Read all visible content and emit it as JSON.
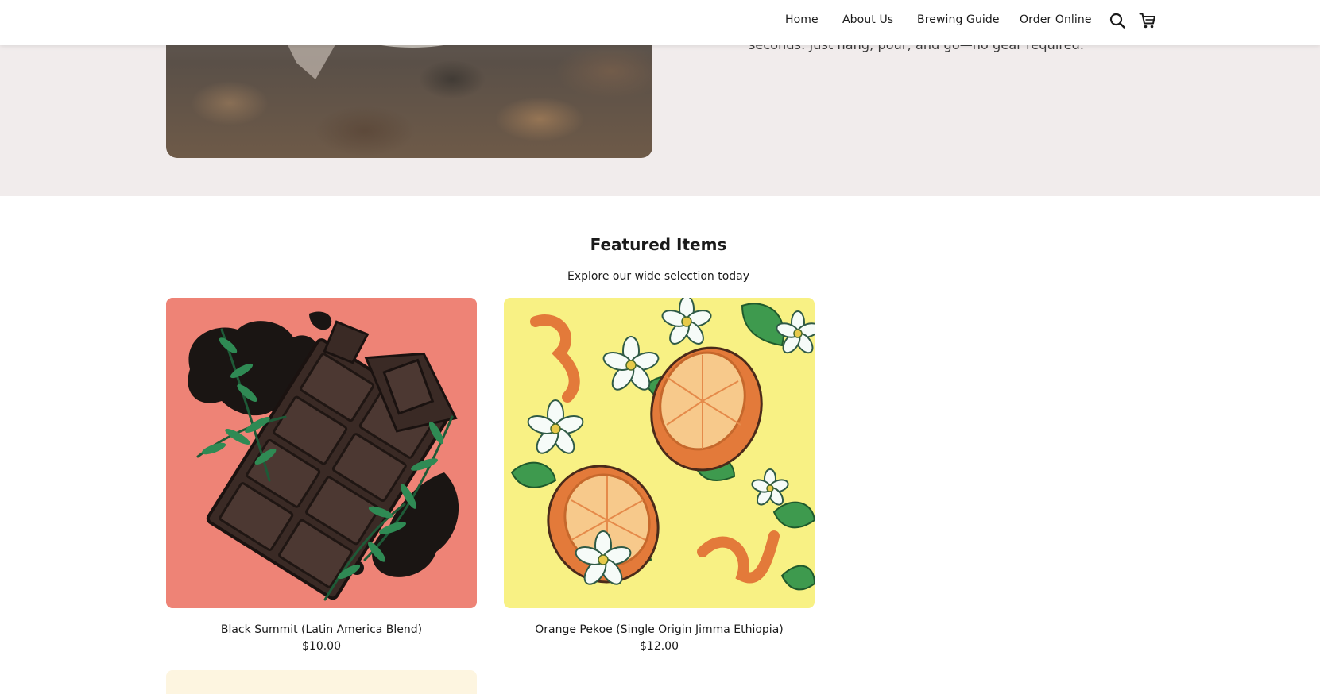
{
  "nav": {
    "links": [
      "Home",
      "About Us",
      "Brewing Guide",
      "Order Online"
    ],
    "icons": [
      "search-icon",
      "cart-icon"
    ]
  },
  "hero": {
    "text": "seconds. Just hang, pour, and go—no gear required.",
    "background_color": "#f1ecec"
  },
  "featured": {
    "title": "Featured Items",
    "subtitle": "Explore our wide selection today",
    "products": [
      {
        "name": "Black Summit (Latin America Blend)",
        "price": "$10.00",
        "image_background": "#ee8376"
      },
      {
        "name": "Orange Pekoe (Single Origin Jimma Ethiopia)",
        "price": "$12.00",
        "image_background": "#f8f184"
      }
    ]
  }
}
